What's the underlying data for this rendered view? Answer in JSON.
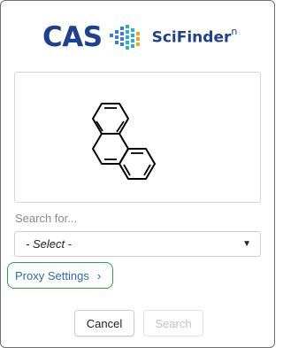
{
  "logo": {
    "cas_text": "CAS",
    "scifinder_text": "SciFinder",
    "scifinder_sup": "n",
    "brand_color": "#1f3f8f"
  },
  "structure": {
    "molecule": "phenanthrene"
  },
  "search_for": {
    "label": "Search for...",
    "selected": "- Select -"
  },
  "proxy": {
    "label": "Proxy Settings",
    "chevron": "›",
    "highlight_color": "#29a24a"
  },
  "buttons": {
    "cancel": "Cancel",
    "search": "Search"
  }
}
